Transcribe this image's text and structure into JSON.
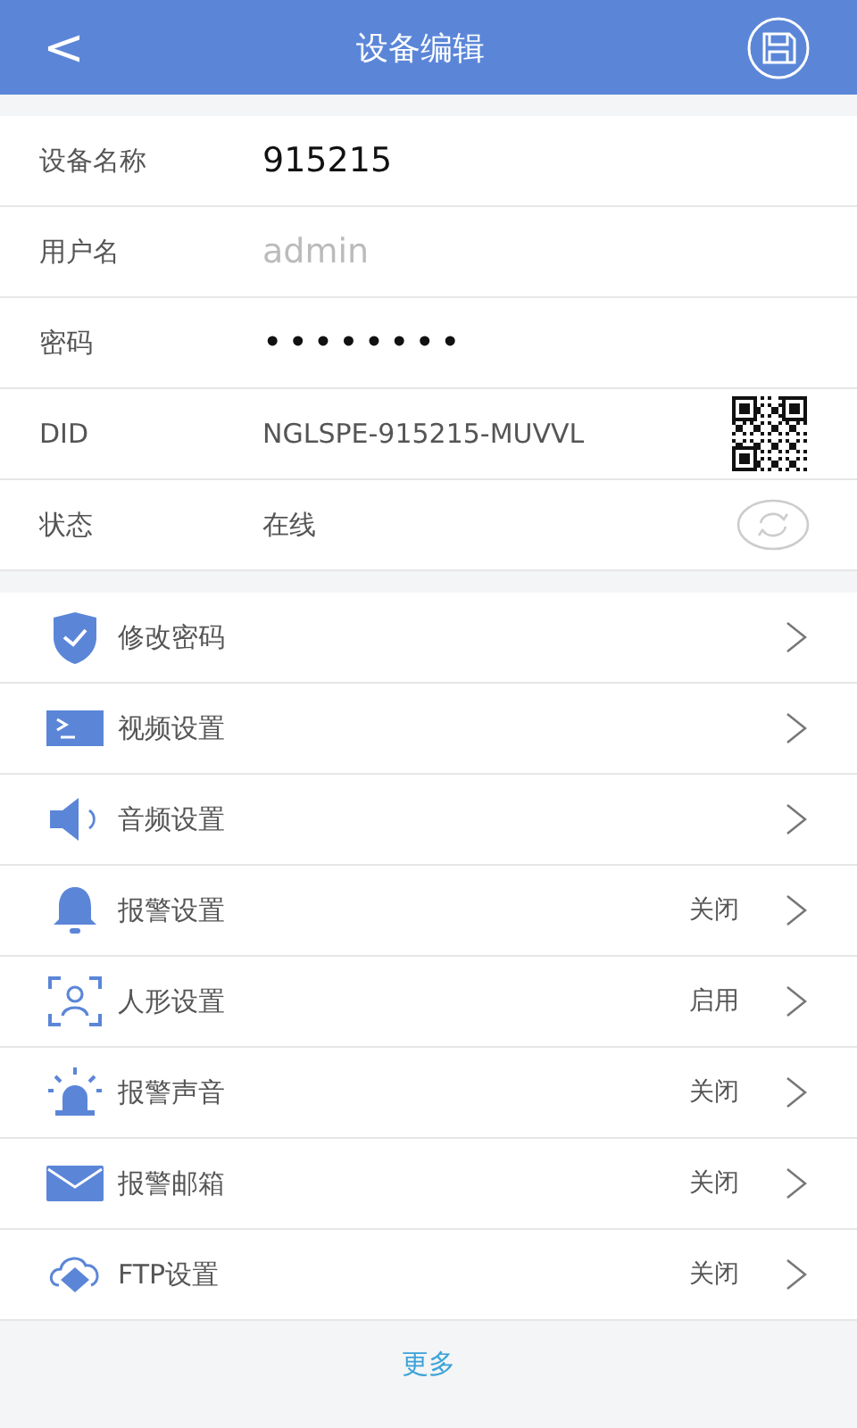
{
  "header": {
    "back": "<",
    "title": "设备编辑"
  },
  "info_rows": [
    {
      "kind": "input",
      "label": "设备名称",
      "value": "915215"
    },
    {
      "kind": "input",
      "label": "用户名",
      "placeholder": "admin"
    },
    {
      "kind": "password",
      "label": "密码",
      "value": "••••••••"
    },
    {
      "kind": "qr",
      "label": "DID",
      "value": "NGLSPE-915215-MUVVL"
    },
    {
      "kind": "status",
      "label": "状态",
      "value": "在线"
    }
  ],
  "menu": [
    {
      "label": "修改密码"
    },
    {
      "label": "视频设置"
    },
    {
      "label": "音频设置"
    },
    {
      "label": "报警设置",
      "status": "关闭"
    },
    {
      "label": "人形设置",
      "status": "启用"
    },
    {
      "label": "报警声音",
      "status": "关闭"
    },
    {
      "label": "报警邮箱",
      "status": "关闭"
    },
    {
      "label": "FTP设置",
      "status": "关闭"
    }
  ],
  "more_link": "更多"
}
